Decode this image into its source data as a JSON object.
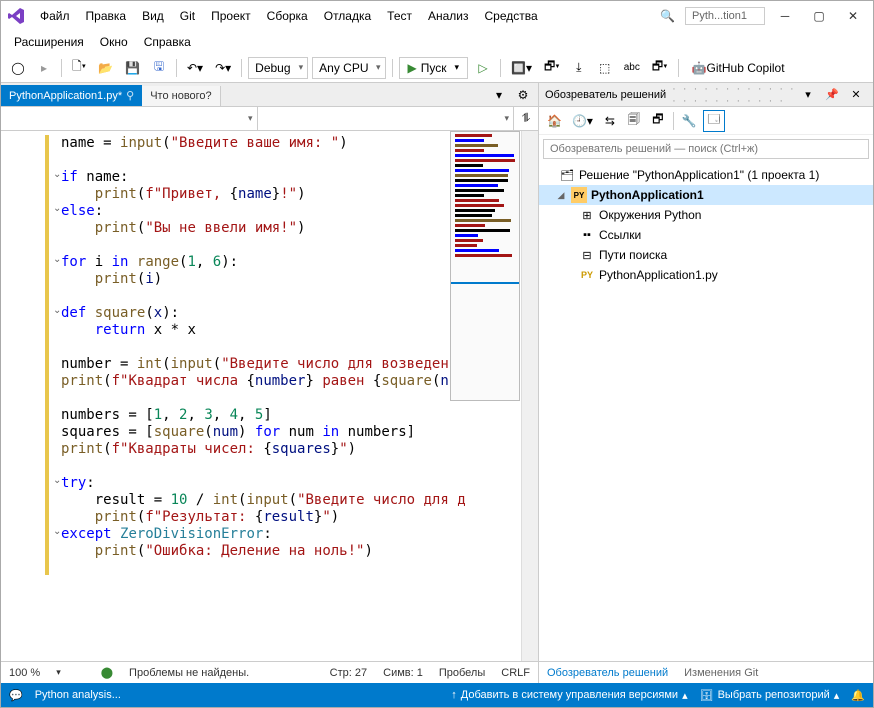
{
  "title_app": "Pyth...tion1",
  "menus1": [
    "Файл",
    "Правка",
    "Вид",
    "Git",
    "Проект",
    "Сборка",
    "Отладка",
    "Тест",
    "Анализ",
    "Средства"
  ],
  "menus2": [
    "Расширения",
    "Окно",
    "Справка"
  ],
  "search_placeholder": "🔍",
  "toolbar": {
    "config": "Debug",
    "platform": "Any CPU",
    "run": "Пуск",
    "copilot": "GitHub Copilot"
  },
  "tabs": {
    "active": "PythonApplication1.py*",
    "second": "Что нового?",
    "pin": "⚲"
  },
  "code": {
    "lines": [
      [
        [
          "",
          "name = "
        ],
        [
          "fn",
          "input"
        ],
        [
          "op",
          "("
        ],
        [
          "str",
          "\"Введите ваше имя: \""
        ],
        [
          "op",
          ")"
        ]
      ],
      [],
      [
        [
          "kw",
          "if"
        ],
        [
          "",
          " name:"
        ]
      ],
      [
        [
          "",
          "    "
        ],
        [
          "fn",
          "print"
        ],
        [
          "op",
          "("
        ],
        [
          "str",
          "f\"Привет, "
        ],
        [
          "op",
          "{"
        ],
        [
          "var",
          "name"
        ],
        [
          "op",
          "}"
        ],
        [
          "str",
          "!\""
        ],
        [
          "op",
          ")"
        ]
      ],
      [
        [
          "kw",
          "else"
        ],
        [
          "op",
          ":"
        ]
      ],
      [
        [
          "",
          "    "
        ],
        [
          "fn",
          "print"
        ],
        [
          "op",
          "("
        ],
        [
          "str",
          "\"Вы не ввели имя!\""
        ],
        [
          "op",
          ")"
        ]
      ],
      [],
      [
        [
          "kw",
          "for"
        ],
        [
          "",
          " i "
        ],
        [
          "kw",
          "in"
        ],
        [
          "",
          " "
        ],
        [
          "fn",
          "range"
        ],
        [
          "op",
          "("
        ],
        [
          "num",
          "1"
        ],
        [
          "op",
          ", "
        ],
        [
          "num",
          "6"
        ],
        [
          "op",
          "):"
        ]
      ],
      [
        [
          "",
          "    "
        ],
        [
          "fn",
          "print"
        ],
        [
          "op",
          "("
        ],
        [
          "var",
          "i"
        ],
        [
          "op",
          ")"
        ]
      ],
      [],
      [
        [
          "kw",
          "def"
        ],
        [
          "",
          " "
        ],
        [
          "fn",
          "square"
        ],
        [
          "op",
          "("
        ],
        [
          "var",
          "x"
        ],
        [
          "op",
          "):"
        ]
      ],
      [
        [
          "",
          "    "
        ],
        [
          "kw",
          "return"
        ],
        [
          "",
          " x * x"
        ]
      ],
      [],
      [
        [
          "",
          "number = "
        ],
        [
          "fn",
          "int"
        ],
        [
          "op",
          "("
        ],
        [
          "fn",
          "input"
        ],
        [
          "op",
          "("
        ],
        [
          "str",
          "\"Введите число для возведения"
        ]
      ],
      [
        [
          "fn",
          "print"
        ],
        [
          "op",
          "("
        ],
        [
          "str",
          "f\"Квадрат числа "
        ],
        [
          "op",
          "{"
        ],
        [
          "var",
          "number"
        ],
        [
          "op",
          "}"
        ],
        [
          "str",
          " равен "
        ],
        [
          "op",
          "{"
        ],
        [
          "fn",
          "square"
        ],
        [
          "op",
          "("
        ],
        [
          "var",
          "num"
        ]
      ],
      [],
      [
        [
          "",
          "numbers = ["
        ],
        [
          "num",
          "1"
        ],
        [
          "op",
          ", "
        ],
        [
          "num",
          "2"
        ],
        [
          "op",
          ", "
        ],
        [
          "num",
          "3"
        ],
        [
          "op",
          ", "
        ],
        [
          "num",
          "4"
        ],
        [
          "op",
          ", "
        ],
        [
          "num",
          "5"
        ],
        [
          "op",
          "]"
        ]
      ],
      [
        [
          "",
          "squares = ["
        ],
        [
          "fn",
          "square"
        ],
        [
          "op",
          "("
        ],
        [
          "var",
          "num"
        ],
        [
          "op",
          ") "
        ],
        [
          "kw",
          "for"
        ],
        [
          "",
          " num "
        ],
        [
          "kw",
          "in"
        ],
        [
          "",
          " numbers]"
        ]
      ],
      [
        [
          "fn",
          "print"
        ],
        [
          "op",
          "("
        ],
        [
          "str",
          "f\"Квадраты чисел: "
        ],
        [
          "op",
          "{"
        ],
        [
          "var",
          "squares"
        ],
        [
          "op",
          "}"
        ],
        [
          "str",
          "\""
        ],
        [
          "op",
          ")"
        ]
      ],
      [],
      [
        [
          "kw",
          "try"
        ],
        [
          "op",
          ":"
        ]
      ],
      [
        [
          "",
          "    result = "
        ],
        [
          "num",
          "10"
        ],
        [
          "",
          " / "
        ],
        [
          "fn",
          "int"
        ],
        [
          "op",
          "("
        ],
        [
          "fn",
          "input"
        ],
        [
          "op",
          "("
        ],
        [
          "str",
          "\"Введите число для д"
        ]
      ],
      [
        [
          "",
          "    "
        ],
        [
          "fn",
          "print"
        ],
        [
          "op",
          "("
        ],
        [
          "str",
          "f\"Результат: "
        ],
        [
          "op",
          "{"
        ],
        [
          "var",
          "result"
        ],
        [
          "op",
          "}"
        ],
        [
          "str",
          "\""
        ],
        [
          "op",
          ")"
        ]
      ],
      [
        [
          "kw",
          "except"
        ],
        [
          "",
          " "
        ],
        [
          "cls",
          "ZeroDivisionError"
        ],
        [
          "op",
          ":"
        ]
      ],
      [
        [
          "",
          "    "
        ],
        [
          "fn",
          "print"
        ],
        [
          "op",
          "("
        ],
        [
          "str",
          "\"Ошибка: Деление на ноль!\""
        ],
        [
          "op",
          ")"
        ]
      ],
      []
    ],
    "folds": [
      2,
      4,
      7,
      10,
      20,
      23
    ]
  },
  "status_editor": {
    "zoom": "100 %",
    "problems": "Проблемы не найдены.",
    "line": "Стр: 27",
    "col": "Симв: 1",
    "indent": "Пробелы",
    "eol": "CRLF"
  },
  "solution": {
    "panel_title": "Обозреватель решений",
    "search_ph": "Обозреватель решений — поиск (Ctrl+ж)",
    "root": "Решение \"PythonApplication1\"  (1 проекта 1)",
    "project": "PythonApplication1",
    "nodes": [
      "Окружения Python",
      "Ссылки",
      "Пути поиска",
      "PythonApplication1.py"
    ],
    "tabs": [
      "Обозреватель решений",
      "Изменения Git"
    ]
  },
  "statusbar": {
    "left": "Python analysis...",
    "vc": "Добавить в систему управления версиями",
    "repo": "Выбрать репозиторий"
  }
}
